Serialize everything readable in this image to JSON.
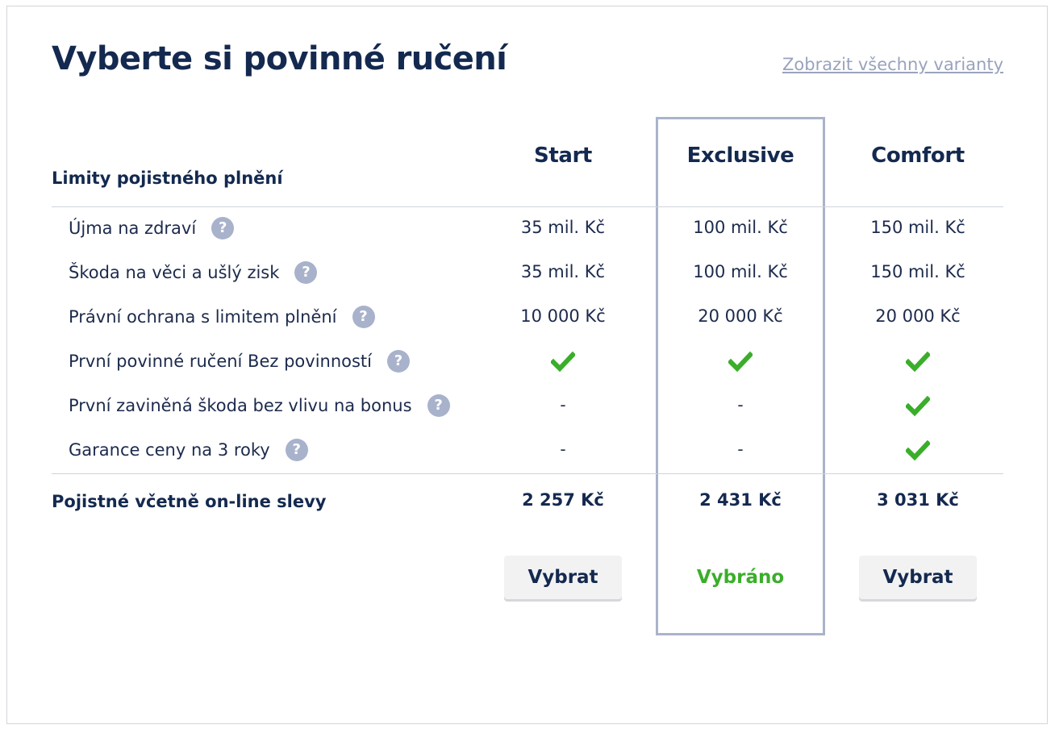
{
  "title": "Vyberte si povinné ručení",
  "show_all_link": "Zobrazit všechny varianty",
  "section_label": "Limity pojistného plnění",
  "plans": [
    {
      "name": "Start",
      "price": "2 257  Kč",
      "button": "Vybrat",
      "selected": false
    },
    {
      "name": "Exclusive",
      "price": "2 431  Kč",
      "button": "Vybráno",
      "selected": true
    },
    {
      "name": "Comfort",
      "price": "3 031  Kč",
      "button": "Vybrat",
      "selected": false
    }
  ],
  "help_symbol": "?",
  "rows": [
    {
      "label": "Újma na zdraví",
      "values": [
        "35 mil. Kč",
        "100 mil. Kč",
        "150 mil. Kč"
      ]
    },
    {
      "label": "Škoda na věci a ušlý zisk",
      "values": [
        "35 mil. Kč",
        "100 mil. Kč",
        "150 mil. Kč"
      ]
    },
    {
      "label": "Právní ochrana s limitem plnění",
      "values": [
        "10 000 Kč",
        "20 000 Kč",
        "20 000 Kč"
      ]
    },
    {
      "label": "První povinné ručení Bez povinností",
      "values": [
        "check",
        "check",
        "check"
      ]
    },
    {
      "label": "První zaviněná škoda bez vlivu na bonus",
      "values": [
        "-",
        "-",
        "check"
      ]
    },
    {
      "label": "Garance ceny na 3 roky",
      "values": [
        "-",
        "-",
        "check"
      ]
    }
  ],
  "total_label": "Pojistné včetně on-line slevy",
  "colors": {
    "heading": "#14294f",
    "check": "#3aae2a",
    "highlight_border": "#a9b4ca",
    "help_badge": "#a8b2cb",
    "link": "#9aa3bd"
  },
  "icons": {
    "check": "check-icon",
    "help": "question-mark-icon"
  }
}
